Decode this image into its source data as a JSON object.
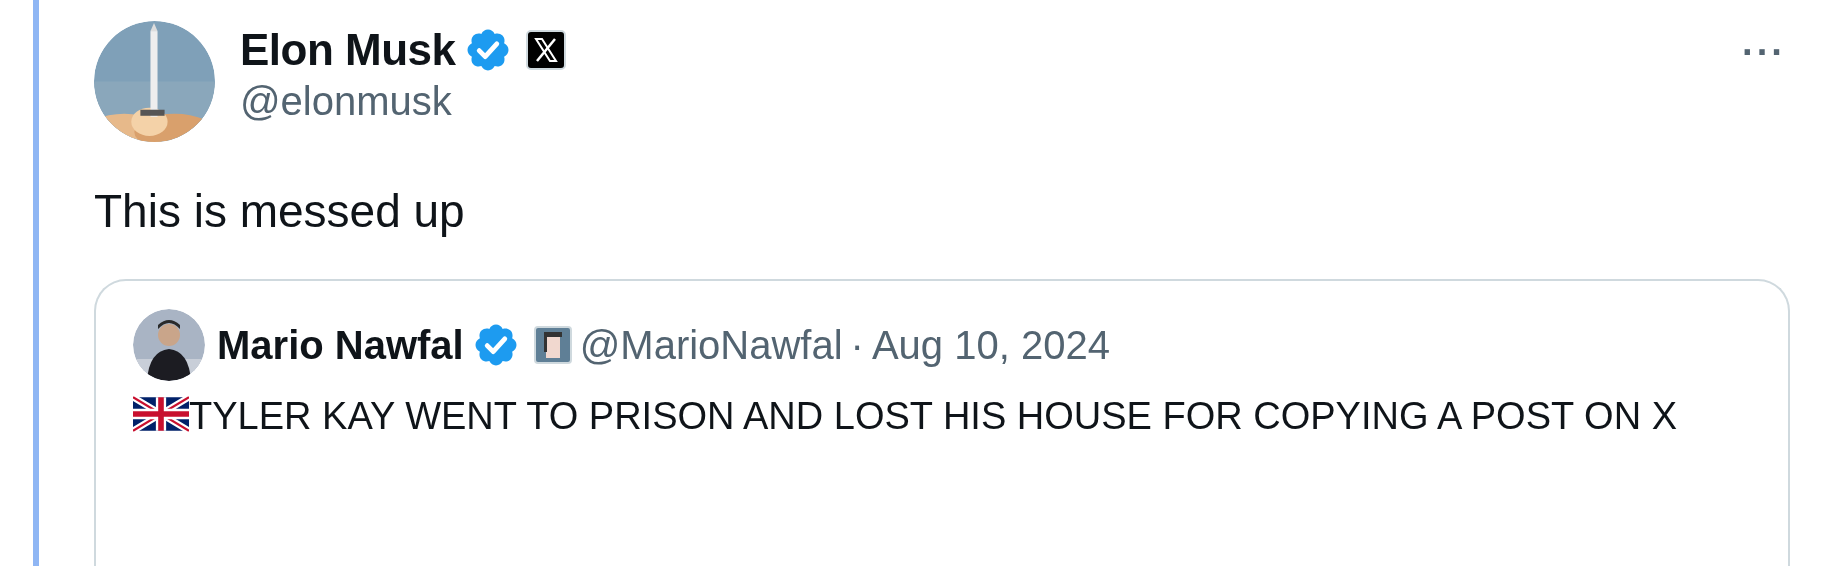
{
  "post": {
    "author": {
      "name": "Elon Musk",
      "handle": "@elonmusk",
      "verified": true,
      "affiliate_logo": true
    },
    "more_label": "···",
    "text": "This is messed up",
    "quoted_post": {
      "author": {
        "name": "Mario Nawfal",
        "handle": "@MarioNawfal",
        "verified": true,
        "affiliate_badge": true
      },
      "separator": "·",
      "date": "Aug 10, 2024",
      "text": "TYLER KAY WENT TO PRISON AND LOST HIS HOUSE FOR COPYING A POST ON X",
      "flag": true
    }
  }
}
